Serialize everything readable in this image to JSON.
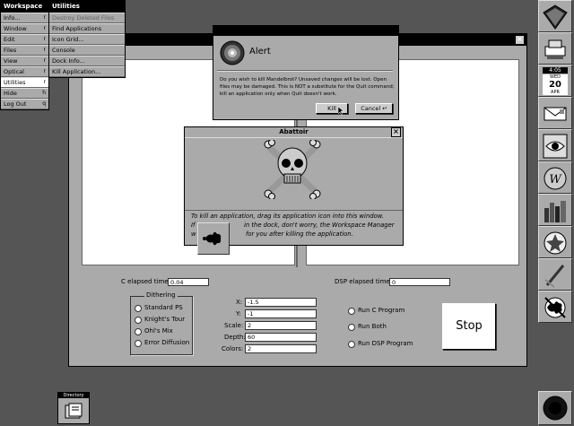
{
  "workspace_menu": {
    "title": "Workspace",
    "items": [
      {
        "label": "Info...",
        "key": "r"
      },
      {
        "label": "Window",
        "key": "r"
      },
      {
        "label": "Edit",
        "key": "r"
      },
      {
        "label": "Files",
        "key": "r"
      },
      {
        "label": "View",
        "key": "r"
      },
      {
        "label": "Optical",
        "key": "r"
      },
      {
        "label": "Utilities",
        "key": "r"
      },
      {
        "label": "Hide",
        "key": "h"
      },
      {
        "label": "Log Out",
        "key": "q"
      }
    ]
  },
  "utilities_menu": {
    "title": "Utilities",
    "items": [
      {
        "label": "Destroy Deleted Files"
      },
      {
        "label": "Find Applications"
      },
      {
        "label": "Icon Grid..."
      },
      {
        "label": "Console"
      },
      {
        "label": "Dock Info..."
      },
      {
        "label": "Kill Application..."
      }
    ]
  },
  "mandelbrot": {
    "c_elapsed_label": "C elapsed time:",
    "c_elapsed_value": "0.04",
    "dsp_elapsed_label": "DSP elapsed time:",
    "dsp_elapsed_value": "0",
    "dithering_title": "Dithering",
    "dithering_options": [
      "Standard PS",
      "Knight's Tour",
      "Ohl's Mix",
      "Error Diffusion"
    ],
    "x_label": "X:",
    "x_value": "-1.5",
    "y_label": "Y:",
    "y_value": "-1",
    "scale_label": "Scale:",
    "scale_value": "2",
    "depth_label": "Depth:",
    "depth_value": "60",
    "colors_label": "Colors:",
    "colors_value": "2",
    "run_options": [
      "Run C Program",
      "Run Both",
      "Run DSP Program"
    ],
    "stop_label": "Stop"
  },
  "alert": {
    "title": "Alert",
    "message": "Do you wish to kill Mandelbrot? Unsaved changes will be lost. Open files may be damaged. This is NOT a substitute for the Quit command; kill an application only when Quit doesn't work.",
    "kill_label": "Kill",
    "cancel_label": "Cancel"
  },
  "abattoir": {
    "title": "Abattoir",
    "line1": "To kill an application, drag its application icon into this window.",
    "line2": "If",
    "line2b": "in the dock, don't worry, the Workspace Manager",
    "line3": "w",
    "line3b": "for you after killing the application."
  },
  "dock": {
    "clock_time": "4:05",
    "clock_month": "APR",
    "clock_day": "20",
    "clock_weekday": "WED"
  },
  "directory_icon": {
    "label": "Directory"
  }
}
